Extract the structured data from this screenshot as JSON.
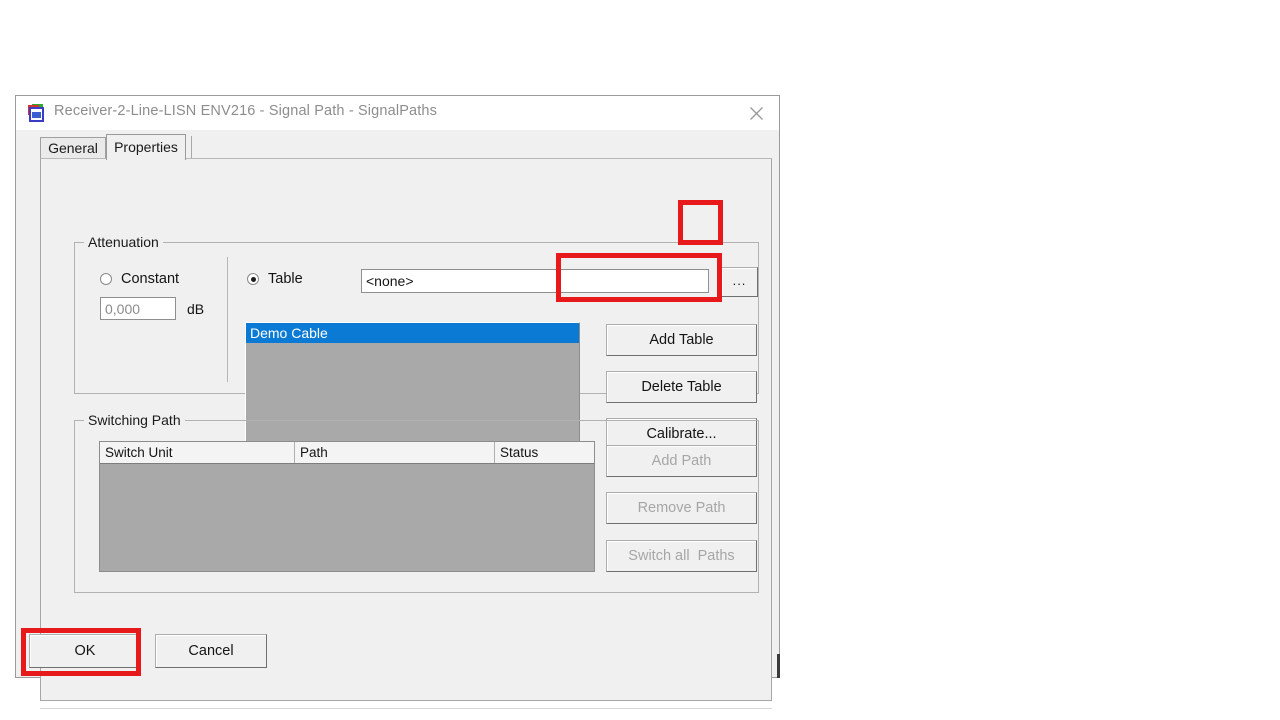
{
  "window": {
    "title": "Receiver-2-Line-LISN ENV216 - Signal Path - SignalPaths",
    "icon": "signal-path-icon",
    "close_icon": "close-icon"
  },
  "tabs": [
    {
      "label": "General",
      "active": false
    },
    {
      "label": "Properties",
      "active": true
    }
  ],
  "attenuation": {
    "legend": "Attenuation",
    "constant": {
      "radio_label": "Constant",
      "selected": false,
      "value": "0,000",
      "unit": "dB"
    },
    "table": {
      "radio_label": "Table",
      "selected": true,
      "field_value": "<none>",
      "browse_label": "...",
      "items": [
        {
          "label": "Demo Cable",
          "selected": true
        }
      ],
      "buttons": [
        {
          "label": "Add Table",
          "enabled": true
        },
        {
          "label": "Delete Table",
          "enabled": true
        },
        {
          "label": "Calibrate...",
          "enabled": true
        }
      ]
    }
  },
  "switching_path": {
    "legend": "Switching Path",
    "columns": [
      "Switch Unit",
      "Path",
      "Status"
    ],
    "rows": [],
    "buttons": [
      {
        "label": "Add Path",
        "enabled": false
      },
      {
        "label": "Remove Path",
        "enabled": false
      },
      {
        "label": "Switch all  Paths",
        "enabled": false
      }
    ]
  },
  "footer": {
    "ok_label": "OK",
    "cancel_label": "Cancel"
  },
  "annotations": {
    "accent_color": "#e8191b",
    "highlighted": [
      "browse-button",
      "add-table-button",
      "ok-button"
    ]
  }
}
